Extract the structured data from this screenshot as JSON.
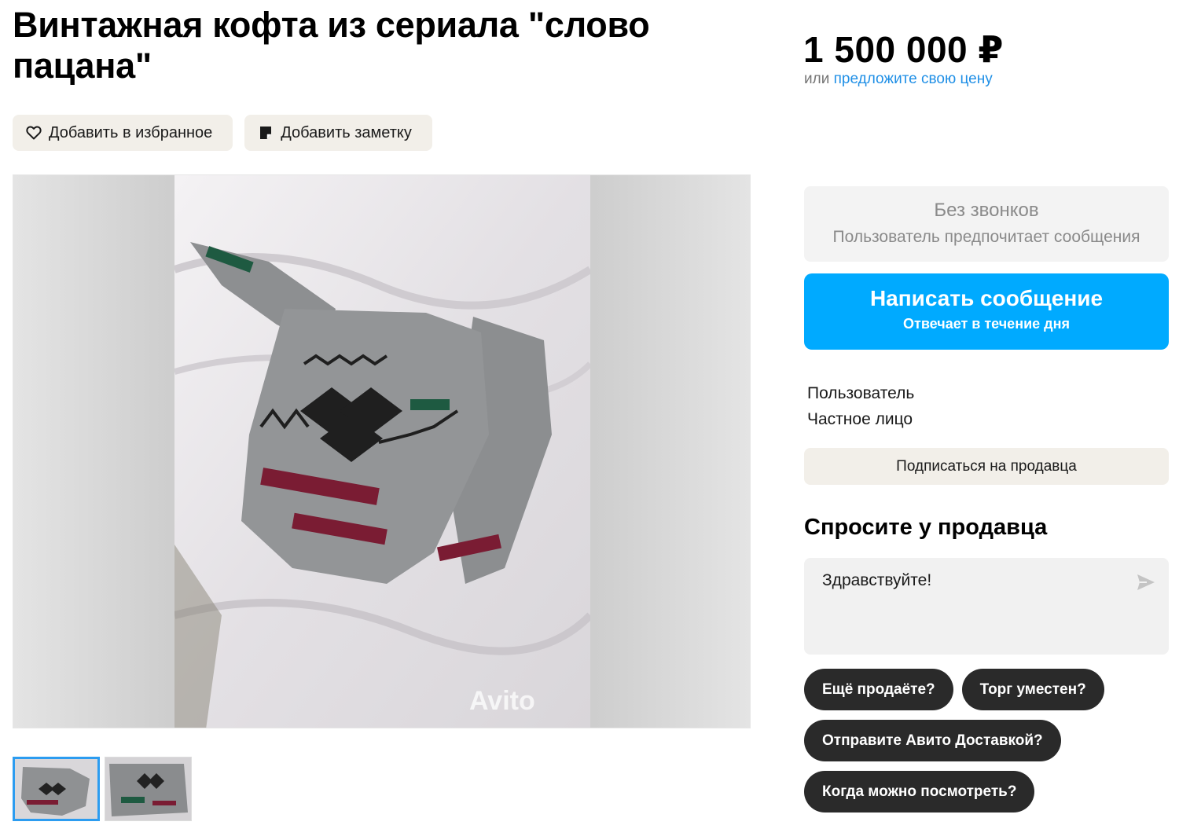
{
  "listing": {
    "title": "Винтажная кофта из сериала \"слово пацана\"",
    "price": "1 500 000 ₽",
    "offer_prefix": "или",
    "offer_link": "предложите свою цену"
  },
  "actions": {
    "favorite_label": "Добавить в избранное",
    "note_label": "Добавить заметку"
  },
  "gallery": {
    "watermark": "Avito",
    "thumbnails_count": 2,
    "active_thumbnail": 1
  },
  "contact": {
    "no_calls_title": "Без звонков",
    "no_calls_subtitle": "Пользователь предпочитает сообщения",
    "message_button": "Написать сообщение",
    "message_button_sub": "Отвечает в течение дня",
    "accent_color": "#00aaff"
  },
  "seller": {
    "name": "Пользователь",
    "type": "Частное лицо",
    "subscribe_label": "Подписаться на продавца"
  },
  "ask": {
    "title": "Спросите у продавца",
    "message_value": "Здравствуйте!",
    "quick_questions": [
      "Ещё продаёте?",
      "Торг уместен?",
      "Отправите Авито Доставкой?",
      "Когда можно посмотреть?"
    ]
  }
}
